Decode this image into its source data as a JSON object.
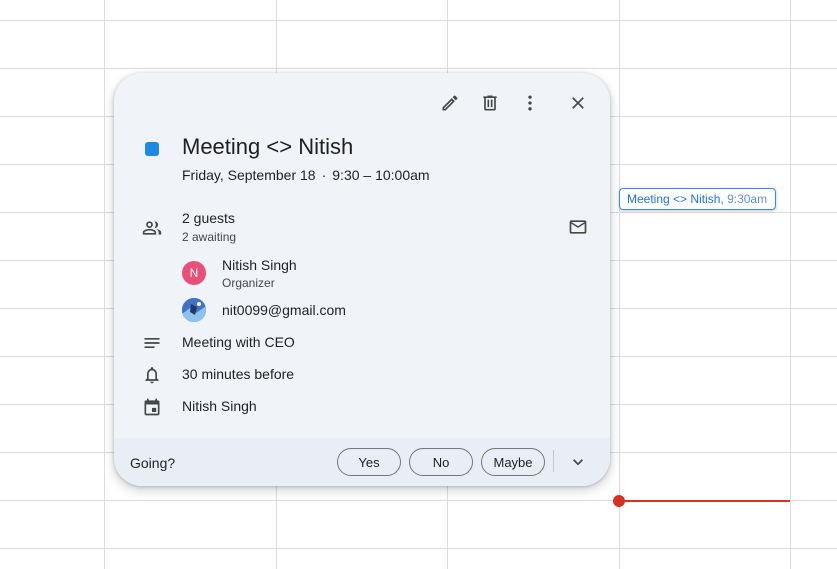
{
  "event_chip": {
    "title": "Meeting <> Nitish,",
    "time": "9:30am"
  },
  "popup": {
    "title": "Meeting <> Nitish",
    "date": "Friday, September 18",
    "separator": "·",
    "time_range": "9:30 – 10:00am",
    "event_color": "#1e88e5",
    "guests": {
      "count_label": "2 guests",
      "status_label": "2 awaiting",
      "list": [
        {
          "avatar_letter": "N",
          "name": "Nitish Singh",
          "role": "Organizer"
        },
        {
          "name": "nit0099@gmail.com"
        }
      ]
    },
    "description": "Meeting with CEO",
    "reminder": "30 minutes before",
    "calendar": "Nitish Singh",
    "footer": {
      "going_label": "Going?",
      "yes": "Yes",
      "no": "No",
      "maybe": "Maybe"
    }
  },
  "icons": {
    "toolbar": [
      "edit-icon",
      "delete-icon",
      "more-vert-icon",
      "close-icon"
    ],
    "rows": [
      "people-icon",
      "mail-icon",
      "notes-icon",
      "bell-icon",
      "calendar-icon"
    ],
    "footer": [
      "chevron-down-icon"
    ]
  }
}
